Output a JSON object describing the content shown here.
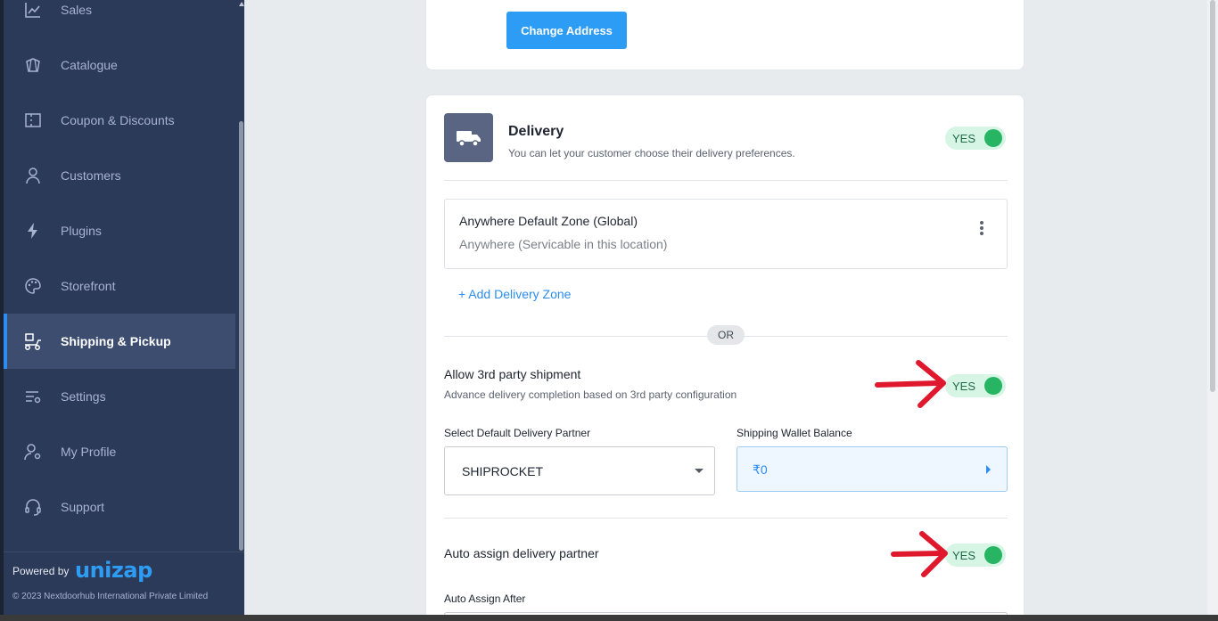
{
  "sidebar": {
    "items": [
      {
        "label": "Sales",
        "icon": "chart-line-icon"
      },
      {
        "label": "Catalogue",
        "icon": "tag-icon"
      },
      {
        "label": "Coupon & Discounts",
        "icon": "coupon-icon"
      },
      {
        "label": "Customers",
        "icon": "user-icon"
      },
      {
        "label": "Plugins",
        "icon": "lightning-icon"
      },
      {
        "label": "Storefront",
        "icon": "palette-icon"
      },
      {
        "label": "Shipping & Pickup",
        "icon": "delivery-scooter-icon",
        "active": true
      },
      {
        "label": "Settings",
        "icon": "settings-sliders-icon"
      },
      {
        "label": "My Profile",
        "icon": "user-gear-icon"
      },
      {
        "label": "Support",
        "icon": "headset-icon"
      }
    ],
    "footer": {
      "powered_by": "Powered by",
      "brand": "unizap",
      "copyright": "© 2023 Nextdoorhub International Private Limited"
    }
  },
  "address_card": {
    "change_address_label": "Change Address"
  },
  "delivery": {
    "title": "Delivery",
    "subtitle": "You can let your customer choose their delivery preferences.",
    "toggle_label": "YES",
    "zone": {
      "title": "Anywhere Default Zone (Global)",
      "subtitle": "Anywhere (Servicable in this location)"
    },
    "add_zone_label": "+ Add Delivery Zone",
    "or_label": "OR",
    "third_party": {
      "title": "Allow 3rd party shipment",
      "subtitle": "Advance delivery completion based on 3rd party configuration",
      "toggle_label": "YES"
    },
    "partner_label": "Select Default Delivery Partner",
    "partner_value": "SHIPROCKET",
    "wallet_label": "Shipping Wallet Balance",
    "wallet_value": "₹0",
    "auto_assign": {
      "title": "Auto assign delivery partner",
      "toggle_label": "YES"
    },
    "auto_assign_after_label": "Auto Assign After"
  },
  "colors": {
    "sidebar_bg": "#2c3a5a",
    "accent": "#2d9cf5",
    "toggle_on": "#27b463",
    "annotation_arrow": "#e0182d"
  }
}
